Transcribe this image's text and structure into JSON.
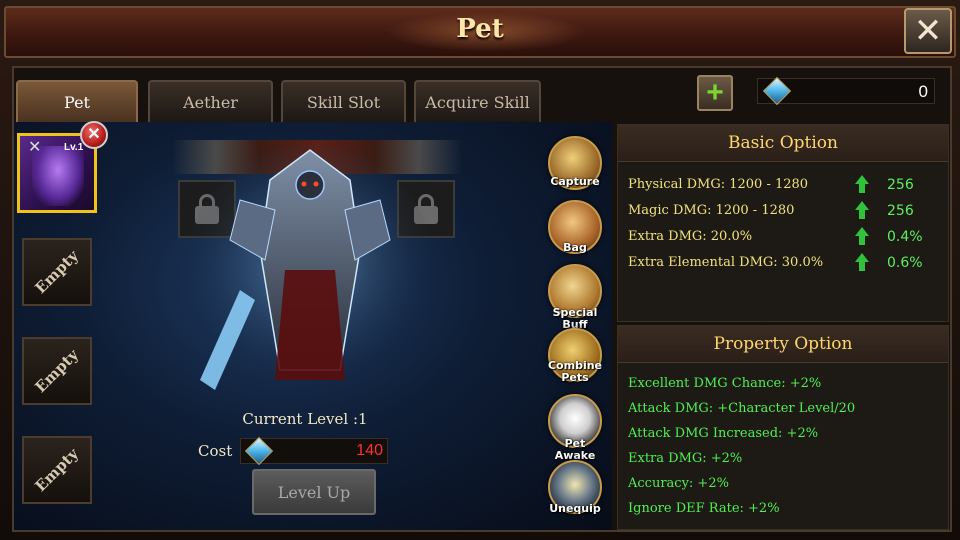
{
  "window": {
    "title": "Pet"
  },
  "tabs": [
    {
      "label": "Pet",
      "active": true
    },
    {
      "label": "Aether",
      "active": false
    },
    {
      "label": "Skill Slot",
      "active": false
    },
    {
      "label": "Acquire Skill",
      "active": false
    }
  ],
  "currency": {
    "icon": "blue-gem-icon",
    "value": "0"
  },
  "pet_slots": {
    "selected": {
      "level_text": "Lv.1"
    },
    "empty_label": "Empty"
  },
  "pet": {
    "current_level_label": "Current Level :",
    "current_level_value": "1",
    "cost_label": "Cost",
    "cost_value": "140",
    "level_up_label": "Level Up"
  },
  "actions": [
    {
      "label": "Capture",
      "icon": "capture-net-icon"
    },
    {
      "label": "Bag",
      "icon": "bag-icon"
    },
    {
      "label": "Special Buff",
      "icon": "special-buff-icon"
    },
    {
      "label": "Combine Pets",
      "icon": "combine-pets-icon"
    },
    {
      "label": "Pet Awake",
      "icon": "panda-icon"
    },
    {
      "label": "Unequip",
      "icon": "unequip-icon"
    }
  ],
  "basic_option": {
    "title": "Basic Option",
    "rows": [
      {
        "label": "Physical DMG: 1200 - 1280",
        "bonus": "256"
      },
      {
        "label": "Magic DMG: 1200 - 1280",
        "bonus": "256"
      },
      {
        "label": "Extra DMG: 20.0%",
        "bonus": "0.4%"
      },
      {
        "label": "Extra Elemental DMG: 30.0%",
        "bonus": "0.6%"
      }
    ]
  },
  "property_option": {
    "title": "Property Option",
    "rows": [
      "Excellent DMG Chance: +2%",
      "Attack DMG: +Character Level/20",
      "Attack DMG Increased: +2%",
      "Extra DMG: +2%",
      "Accuracy: +2%",
      "Ignore DEF Rate: +2%"
    ]
  },
  "colors": {
    "accent_gold": "#ffd76a",
    "bonus_green": "#5cf05c",
    "cost_red": "#ff3030",
    "selected_border": "#f0c21a"
  }
}
